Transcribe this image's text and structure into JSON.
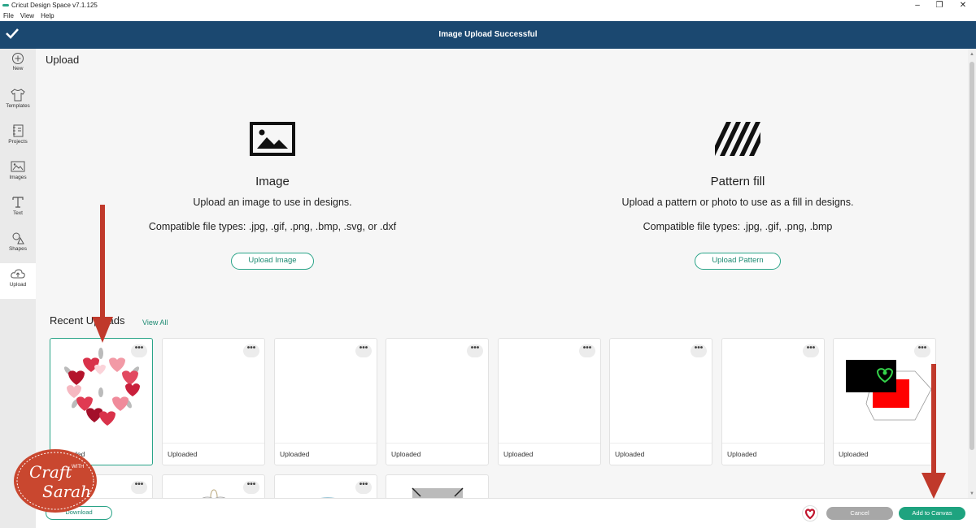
{
  "window": {
    "title": "Cricut Design Space  v7.1.125",
    "controls": [
      "–",
      "❐",
      "✕"
    ]
  },
  "menu": [
    "File",
    "View",
    "Help"
  ],
  "banner": {
    "title": "Image Upload Successful"
  },
  "sidebar": {
    "items": [
      {
        "label": "New",
        "icon": "plus-circle-icon"
      },
      {
        "label": "Templates",
        "icon": "tshirt-icon"
      },
      {
        "label": "Projects",
        "icon": "notebook-icon"
      },
      {
        "label": "Images",
        "icon": "image-icon"
      },
      {
        "label": "Text",
        "icon": "text-t-icon"
      },
      {
        "label": "Shapes",
        "icon": "shapes-icon"
      },
      {
        "label": "Upload",
        "icon": "cloud-upload-icon"
      }
    ]
  },
  "page": {
    "title": "Upload"
  },
  "panels": [
    {
      "title": "Image",
      "description": "Upload an image to use in designs.",
      "filetypes": "Compatible file types: .jpg, .gif, .png, .bmp, .svg, or .dxf",
      "button": "Upload Image"
    },
    {
      "title": "Pattern fill",
      "description": "Upload a pattern or photo to use as a fill in designs.",
      "filetypes": "Compatible file types: .jpg, .gif, .png, .bmp",
      "button": "Upload Pattern"
    }
  ],
  "recent": {
    "title": "Recent Uploads",
    "view_all": "View All",
    "card_label": "Uploaded",
    "more_glyph": "•••"
  },
  "bottom": {
    "download": "Download",
    "cancel": "Cancel",
    "add_to_canvas": "Add to Canvas"
  },
  "watermark": {
    "line1": "Craft",
    "small": "WITH",
    "line2": "Sarah"
  },
  "colors": {
    "banner": "#1b4870",
    "accent": "#2aa488",
    "add_button": "#1ea37f",
    "annotation_arrow": "#c0392b"
  }
}
